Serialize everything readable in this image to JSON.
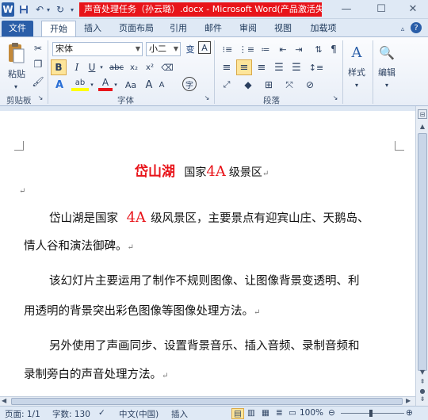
{
  "window": {
    "title": "声音处理任务（孙云璐）.docx - Microsoft Word(产品激活失...",
    "app_icon": "W"
  },
  "tabs": [
    "文件",
    "开始",
    "插入",
    "页面布局",
    "引用",
    "邮件",
    "审阅",
    "视图",
    "加载项"
  ],
  "active_tab": "开始",
  "ribbon": {
    "paste_label": "粘贴",
    "font_name": "宋体",
    "font_size": "小二",
    "style_label": "样式",
    "edit_label": "编辑",
    "groups": [
      "剪贴板",
      "字体",
      "段落"
    ],
    "icons": {
      "bold": "B",
      "italic": "I",
      "underline": "U",
      "strike": "abc",
      "subscript": "x₂",
      "superscript": "x²",
      "font_color": "A",
      "grow": "A",
      "pinyin": "变",
      "border_char": "A",
      "change_case": "Aa",
      "enclose": "字"
    }
  },
  "document": {
    "heading": {
      "name": "岱山湖",
      "pre": "国家",
      "grade": "4A",
      "post": "级景区"
    },
    "paragraphs": [
      {
        "line1_pre": "岱山湖是国家",
        "line1_grade": "4A",
        "line1_post": "级风景区，主要景点有迎宾山庄、天鹅岛、",
        "line2": "情人谷和演法御碑。"
      },
      {
        "line1": "该幻灯片主要运用了制作不规则图像、让图像背景变透明、利",
        "line2": "用透明的背景突出彩色图像等图像处理方法。"
      },
      {
        "line1": "另外使用了声画同步、设置背景音乐、插入音频、录制音频和",
        "line2": "录制旁白的声音处理方法。"
      }
    ],
    "para_mark": "↵"
  },
  "status": {
    "page": "页面: 1/1",
    "words": "字数: 130",
    "language": "中文(中国)",
    "mode": "插入",
    "zoom": "100%"
  },
  "colors": {
    "accent_red": "#e8141a",
    "file_tab": "#2a5ea8"
  }
}
